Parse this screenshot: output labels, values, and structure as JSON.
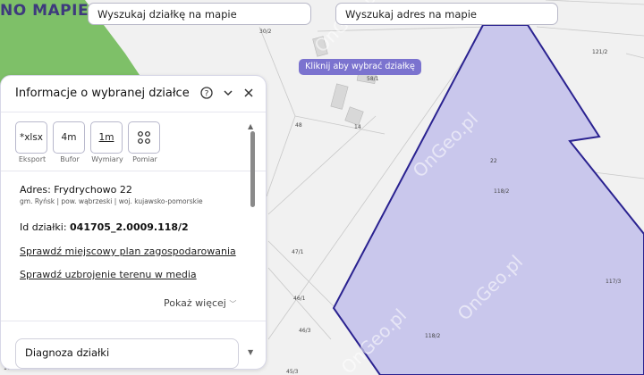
{
  "logo": {
    "text": "NO MAPIE"
  },
  "search": {
    "parcel_label": "Wyszukaj działkę na mapie",
    "address_label": "Wyszukaj adres na mapie"
  },
  "map": {
    "tooltip": "Kliknij aby wybrać działkę",
    "watermark": "OnGeo.pl",
    "parcel_labels": [
      "30/2",
      "58/1",
      "48",
      "14",
      "22",
      "118/2",
      "121/2",
      "117/3",
      "47/1",
      "46/1",
      "46/3",
      "45/3",
      "118/2",
      "1012"
    ]
  },
  "panel": {
    "title": "Informacje o wybranej działce",
    "tools": [
      {
        "icon_text": "*xlsx",
        "label": "Eksport",
        "icon": "export-icon"
      },
      {
        "icon_text": "4m",
        "label": "Bufor",
        "icon": "buffer-icon"
      },
      {
        "icon_text": "1m",
        "label": "Wymiary",
        "icon": "ruler-icon"
      },
      {
        "icon_text": "⚲",
        "label": "Pomiar",
        "icon": "measure-icon"
      }
    ],
    "address": "Adres: Frydrychowo 22",
    "address_sub": "gm. Ryńsk | pow. wąbrzeski | woj. kujawsko-pomorskie",
    "id_label": "Id działki: ",
    "id_value": "041705_2.0009.118/2",
    "link_plan": "Sprawdź miejscowy plan zagospodarowania",
    "link_media": "Sprawdź uzbrojenie terenu w media",
    "show_more": "Pokaż więcej",
    "diagnosis": "Diagnoza działki"
  },
  "colors": {
    "accent": "#7b73cf",
    "parcel_fill": "#c9c7ec",
    "parcel_stroke": "#2a2290",
    "forest": "#7ec068"
  }
}
